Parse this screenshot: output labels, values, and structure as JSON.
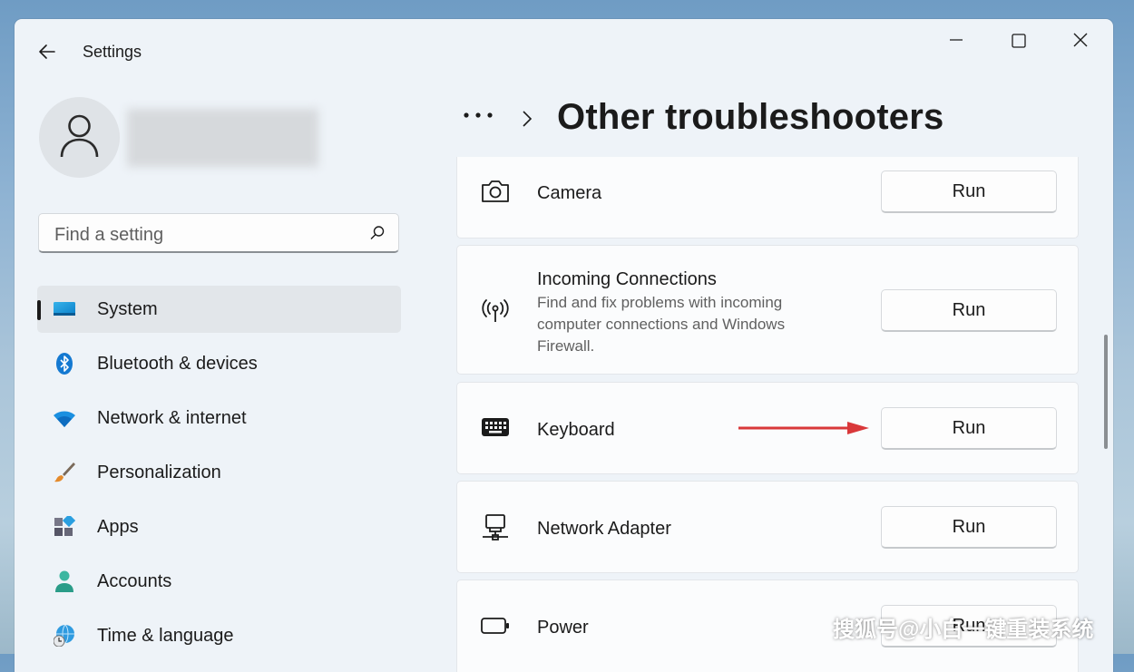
{
  "window": {
    "title": "Settings"
  },
  "search": {
    "placeholder": "Find a setting"
  },
  "nav": [
    {
      "label": "System",
      "icon": "display-icon",
      "active": true
    },
    {
      "label": "Bluetooth & devices",
      "icon": "bluetooth-icon"
    },
    {
      "label": "Network & internet",
      "icon": "wifi-icon"
    },
    {
      "label": "Personalization",
      "icon": "paintbrush-icon"
    },
    {
      "label": "Apps",
      "icon": "apps-icon"
    },
    {
      "label": "Accounts",
      "icon": "person-icon"
    },
    {
      "label": "Time & language",
      "icon": "globe-clock-icon"
    }
  ],
  "header": {
    "breadcrumb_more": "•••",
    "title": "Other troubleshooters"
  },
  "troubleshooters": [
    {
      "title": "Camera",
      "icon": "camera-icon",
      "button": "Run"
    },
    {
      "title": "Incoming Connections",
      "description": "Find and fix problems with incoming computer connections and Windows Firewall.",
      "icon": "antenna-icon",
      "button": "Run"
    },
    {
      "title": "Keyboard",
      "icon": "keyboard-icon",
      "button": "Run"
    },
    {
      "title": "Network Adapter",
      "icon": "network-adapter-icon",
      "button": "Run"
    },
    {
      "title": "Power",
      "icon": "battery-icon",
      "button": "Run"
    }
  ],
  "annotation": {
    "arrow_color": "#d9383a"
  },
  "watermark": "搜狐号@小白一键重装系统",
  "colors": {
    "accent": "#0067c0",
    "window_bg": "#eef3f8",
    "card_bg": "#fbfcfd"
  }
}
